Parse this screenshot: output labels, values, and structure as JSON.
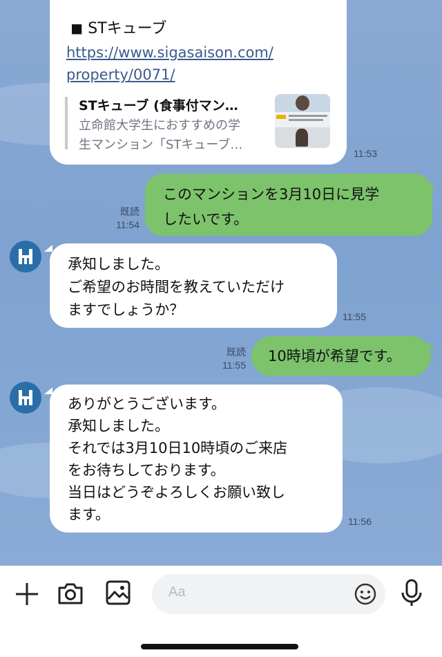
{
  "messages": {
    "link_card": {
      "title_line": "◼ STキューブ",
      "url_line1": "https://www.sigasaison.com/",
      "url_line2": "property/0071/",
      "preview_title": "STキューブ (食事付マン…",
      "preview_desc1": "立命館大学生におすすめの学",
      "preview_desc2": "生マンション「STキューブ…",
      "time": "11:53"
    },
    "m1": {
      "lines": [
        "このマンションを3月10日に見学",
        "したいです。"
      ],
      "read": "既読",
      "time": "11:54"
    },
    "m2": {
      "lines": [
        "承知しました。",
        "ご希望のお時間を教えていただけ",
        "ますでしょうか？"
      ],
      "time": "11:55"
    },
    "m3": {
      "lines": [
        "10時頃が希望です。"
      ],
      "read": "既読",
      "time": "11:55"
    },
    "m4": {
      "lines": [
        "ありがとうございます。",
        "承知しました。",
        "それでは3月10日10時頃のご来店",
        "をお待ちしております。",
        "当日はどうぞよろしくお願い致し",
        "ます。"
      ],
      "time": "11:56"
    }
  },
  "toolbar": {
    "input_placeholder": "Aa",
    "icons": [
      "plus-icon",
      "camera-icon",
      "image-icon",
      "emoji-icon",
      "microphone-icon"
    ]
  },
  "colors": {
    "chat_background": "#8aa9d4",
    "sent_bubble": "#7cc36b",
    "received_bubble": "#ffffff",
    "avatar": "#2a6ea8"
  }
}
